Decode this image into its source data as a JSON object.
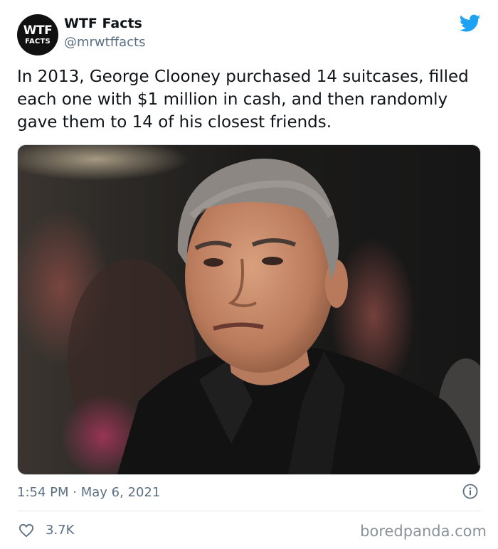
{
  "author": {
    "avatar_line1": "WTF",
    "avatar_line2": "FACTS",
    "display_name": "WTF Facts",
    "handle": "@mrwtffacts"
  },
  "tweet": {
    "text": "In 2013, George Clooney purchased 14 suitcases, filled each one with $1 million in cash, and then randomly gave them to 14 of his closest friends.",
    "timestamp": "1:54 PM · May 6, 2021",
    "likes": "3.7K"
  },
  "icons": {
    "brand": "twitter-bird-icon",
    "info": "info-icon",
    "like": "heart-icon"
  },
  "colors": {
    "twitter_blue": "#1da1f2",
    "secondary_text": "#5b7083"
  },
  "watermark": "boredpanda.com"
}
